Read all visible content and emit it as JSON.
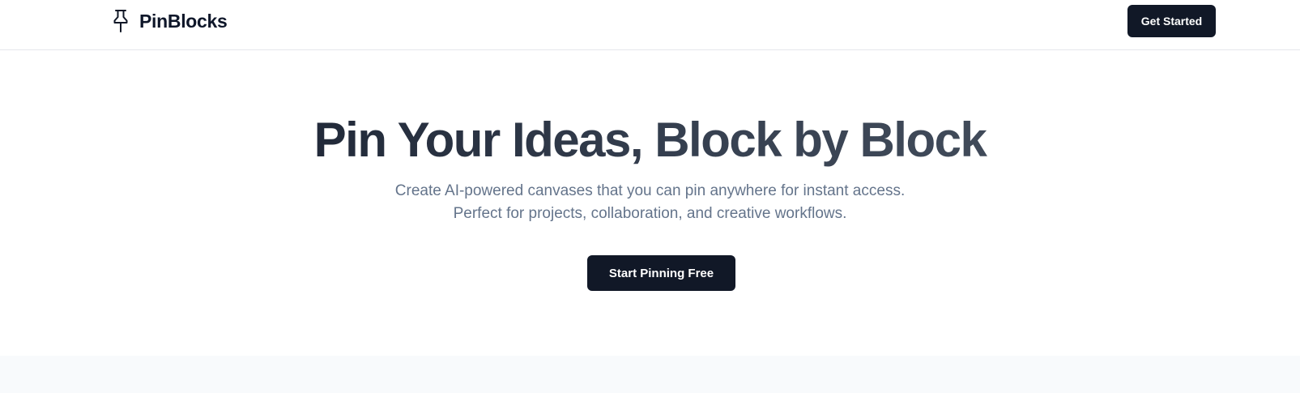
{
  "navbar": {
    "brand_name": "PinBlocks",
    "brand_icon": "pin-icon",
    "cta_label": "Get Started"
  },
  "hero": {
    "title": "Pin Your Ideas, Block by Block",
    "subtitle_line1": "Create AI-powered canvases that you can pin anywhere for instant access.",
    "subtitle_line2": "Perfect for projects, collaboration, and creative workflows.",
    "cta_label": "Start Pinning Free"
  },
  "colors": {
    "primary_button": "#111827",
    "title_start": "#111827",
    "title_end": "#4b5563",
    "subtitle": "#64748b",
    "section_bg": "#f8fafc"
  }
}
